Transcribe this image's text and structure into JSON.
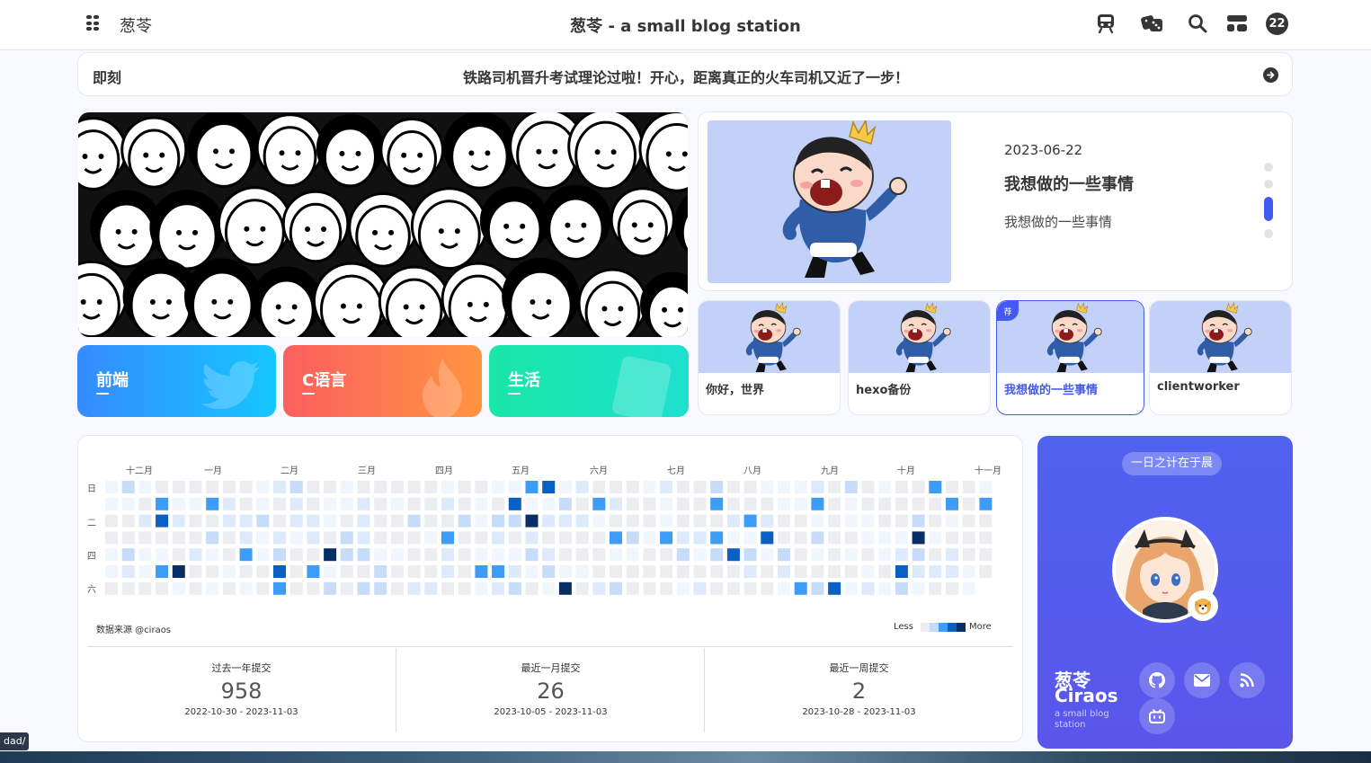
{
  "nav": {
    "site_name": "葱苓",
    "center_title": "葱苓 - a small blog station",
    "badge": "22",
    "icons": [
      "menu-icon",
      "subway-icon",
      "dice-icon",
      "search-icon",
      "layout-icon"
    ]
  },
  "notice": {
    "label": "即刻",
    "text": "铁路司机晋升考试理论过啦！开心，距离真正的火车司机又近了一步！"
  },
  "categories": [
    {
      "label": "前端",
      "color": "#2f88f7"
    },
    {
      "label": "C语言",
      "color": "#fb6c4c"
    },
    {
      "label": "生活",
      "color": "#1fe0b9"
    }
  ],
  "featured": {
    "date": "2023-06-22",
    "title": "我想做的一些事情",
    "description": "我想做的一些事情"
  },
  "recent_posts": [
    {
      "title": "你好，世界"
    },
    {
      "title": "hexo备份"
    },
    {
      "title": "我想做的一些事情",
      "badge": "荐"
    },
    {
      "title": "clientworker"
    }
  ],
  "heatmap": {
    "months": [
      "十二月",
      "一月",
      "二月",
      "三月",
      "四月",
      "五月",
      "六月",
      "七月",
      "八月",
      "九月",
      "十月",
      "十一月"
    ],
    "weekdays": [
      "日",
      "二",
      "四",
      "六"
    ],
    "source": "数据来源 @ciraos",
    "legend_less": "Less",
    "legend_more": "More",
    "stats": [
      {
        "label": "过去一年提交",
        "value": "958",
        "range": "2022-10-30 - 2023-11-03"
      },
      {
        "label": "最近一月提交",
        "value": "26",
        "range": "2023-10-05 - 2023-11-03"
      },
      {
        "label": "最近一周提交",
        "value": "2",
        "range": "2023-10-28 - 2023-11-03"
      }
    ]
  },
  "author": {
    "motto": "一日之计在于晨",
    "name_cn": "葱苓",
    "name_en": "Ciraos",
    "subtitle": "a small blog station",
    "icons": [
      "github-icon",
      "mail-icon",
      "rss-icon",
      "bilibili-icon"
    ]
  },
  "status_tooltip": "dad/"
}
